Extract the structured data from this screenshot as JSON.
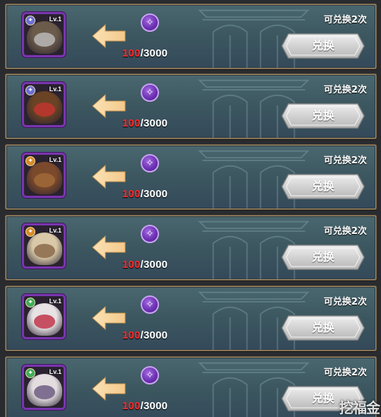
{
  "theme": {
    "frame": "#a08a66",
    "panel": "#3d5860",
    "portrait_border": "#7a35b0",
    "arrow": "#f3c98b",
    "progress_current": "#ff2a2a",
    "button": "#d7d7d7"
  },
  "rows": [
    {
      "level": "Lv.1",
      "faction_icon": "lightbearer-icon",
      "faction_color": "#6b6fd8",
      "face_color": "#6b5b4a",
      "accent_color": "#b9b9b9",
      "current": "100",
      "total": "/3000",
      "remaining": "可兑换2次",
      "button": "兑换"
    },
    {
      "level": "Lv.1",
      "faction_icon": "lightbearer-icon",
      "faction_color": "#6b6fd8",
      "face_color": "#6a4325",
      "accent_color": "#c0352e",
      "current": "100",
      "total": "/3000",
      "remaining": "可兑换2次",
      "button": "兑换"
    },
    {
      "level": "Lv.1",
      "faction_icon": "mauler-icon",
      "faction_color": "#d88b2a",
      "face_color": "#7b4a2c",
      "accent_color": "#a06838",
      "current": "100",
      "total": "/3000",
      "remaining": "可兑换2次",
      "button": "兑换"
    },
    {
      "level": "Lv.1",
      "faction_icon": "mauler-icon",
      "faction_color": "#d88b2a",
      "face_color": "#d9c9a8",
      "accent_color": "#8a6a4a",
      "current": "100",
      "total": "/3000",
      "remaining": "可兑换2次",
      "button": "兑换"
    },
    {
      "level": "Lv.1",
      "faction_icon": "wilder-icon",
      "faction_color": "#3fae5a",
      "face_color": "#e7e2e4",
      "accent_color": "#c0354a",
      "current": "100",
      "total": "/3000",
      "remaining": "可兑换2次",
      "button": "兑换"
    },
    {
      "level": "Lv.1",
      "faction_icon": "wilder-icon",
      "faction_color": "#3fae5a",
      "face_color": "#e3dde0",
      "accent_color": "#6d5d82",
      "current": "100",
      "total": "/3000",
      "remaining": "可兑换2次",
      "button": "兑换"
    }
  ],
  "watermark": "挖福金"
}
